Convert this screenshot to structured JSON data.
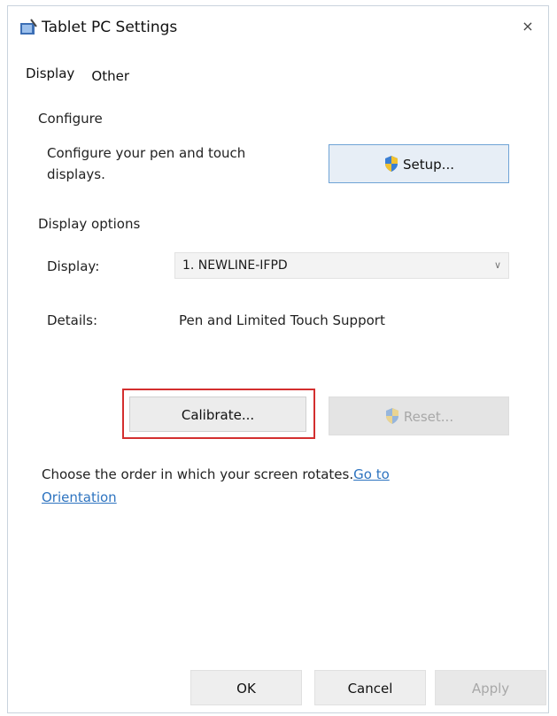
{
  "window": {
    "title": "Tablet PC Settings",
    "close_glyph": "×"
  },
  "tabs": [
    {
      "label": "Display",
      "active": true
    },
    {
      "label": "Other",
      "active": false
    }
  ],
  "configure": {
    "heading": "Configure",
    "description_line1": "Configure your pen and touch",
    "description_line2": "displays.",
    "setup_label": "Setup..."
  },
  "display_options": {
    "heading": "Display options",
    "display_label": "Display:",
    "display_value": "1. NEWLINE-IFPD",
    "details_label": "Details:",
    "details_value": "Pen and Limited Touch Support",
    "calibrate_label": "Calibrate...",
    "reset_label": "Reset..."
  },
  "orientation": {
    "text": "Choose the order in which your screen rotates.",
    "link_label": "Go to Orientation"
  },
  "footer": {
    "ok_label": "OK",
    "cancel_label": "Cancel",
    "apply_label": "Apply"
  },
  "colors": {
    "highlight": "#d32f2f",
    "link": "#2e74c0",
    "setup_border": "#6fa3d6"
  },
  "icons": {
    "app": "tablet-pen-icon",
    "shield": "uac-shield-icon",
    "chevron": "chevron-down-icon"
  }
}
